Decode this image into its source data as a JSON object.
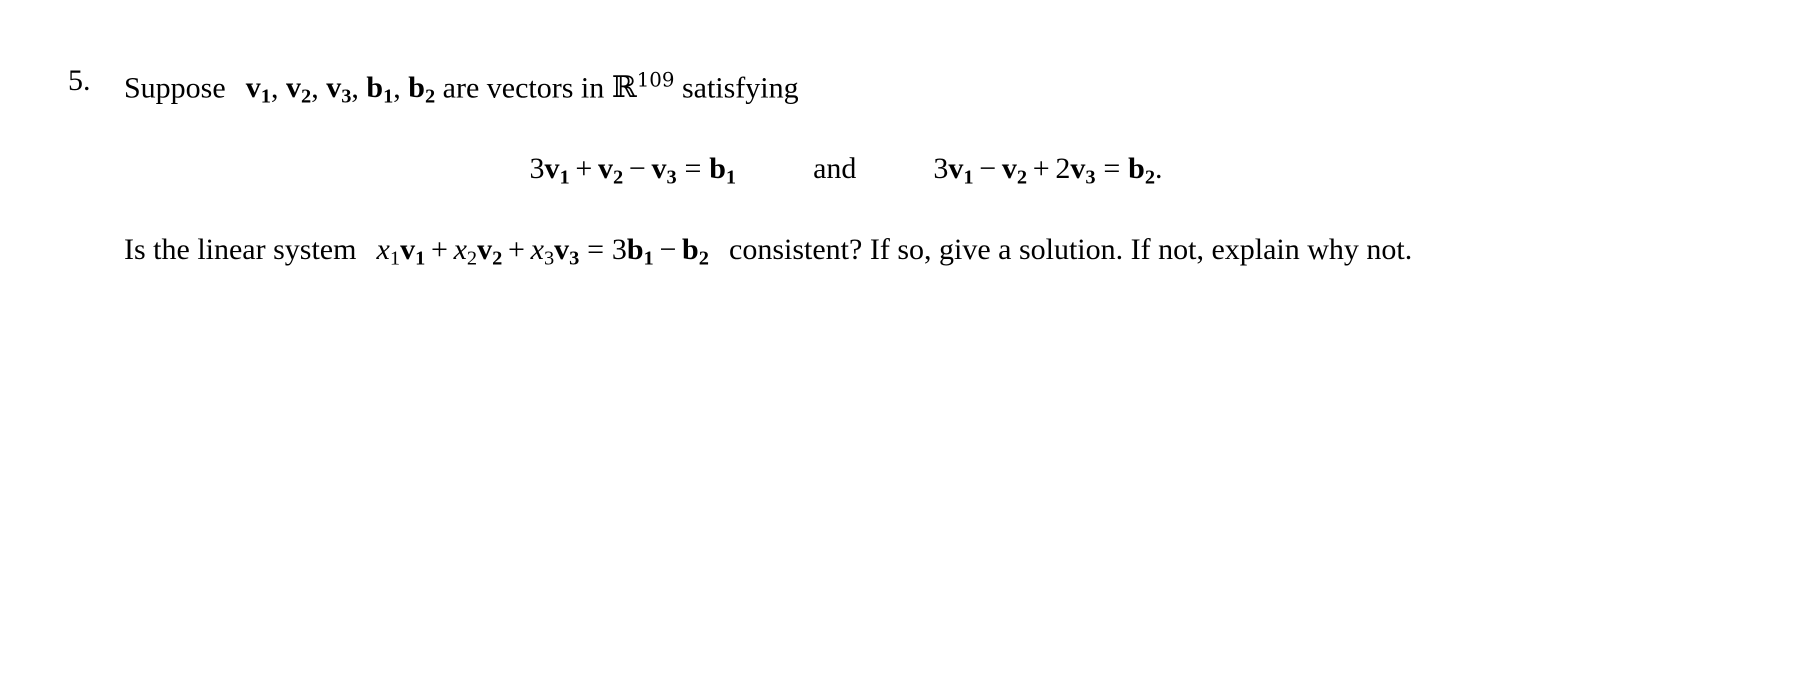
{
  "document": {
    "kind": "math-exercise",
    "background_color": "#ffffff",
    "text_color": "#000000"
  },
  "problem": {
    "number": "5.",
    "stem": {
      "lead": "Suppose",
      "vector_list": [
        "v",
        "v",
        "v",
        "b",
        "b"
      ],
      "vector_subscripts": [
        "1",
        "2",
        "3",
        "1",
        "2"
      ],
      "middle": "are vectors in",
      "field_symbol": "R",
      "field_exponent": "109",
      "trail": "satisfying",
      "full_text": "Suppose v1, v2, v3, b1, b2 are vectors in R^109 satisfying"
    },
    "equations": {
      "conjunction": "and",
      "first": {
        "coef1": "3",
        "var1": "v",
        "sub1": "1",
        "op1": "+",
        "coef2": "",
        "var2": "v",
        "sub2": "2",
        "op2": "−",
        "coef3": "",
        "var3": "v",
        "sub3": "3",
        "relation": "=",
        "rhs_var": "b",
        "rhs_sub": "1",
        "full_text": "3v1 + v2 − v3 = b1"
      },
      "second": {
        "coef1": "3",
        "var1": "v",
        "sub1": "1",
        "op1": "−",
        "coef2": "",
        "var2": "v",
        "sub2": "2",
        "op2": "+",
        "coef3": "2",
        "var3": "v",
        "sub3": "3",
        "relation": "=",
        "rhs_var": "b",
        "rhs_sub": "2",
        "terminator": ".",
        "full_text": "3v1 − v2 + 2v3 = b2."
      }
    },
    "question": {
      "lead": "Is the linear system",
      "system": {
        "t1_scalar": "x",
        "t1_scalar_sub": "1",
        "t1_vec": "v",
        "t1_vec_sub": "1",
        "op1": "+",
        "t2_scalar": "x",
        "t2_scalar_sub": "2",
        "t2_vec": "v",
        "t2_vec_sub": "2",
        "op2": "+",
        "t3_scalar": "x",
        "t3_scalar_sub": "3",
        "t3_vec": "v",
        "t3_vec_sub": "3",
        "relation": "=",
        "rhs_coef": "3",
        "rhs_var1": "b",
        "rhs_sub1": "1",
        "rhs_op": "−",
        "rhs_var2": "b",
        "rhs_sub2": "2",
        "full_text": "x1v1 + x2v2 + x3v3 = 3b1 − b2"
      },
      "tail": "consistent?  If so, give a solution.  If not, explain why not.",
      "full_text": "Is the linear system x1v1 + x2v2 + x3v3 = 3b1 − b2 consistent? If so, give a solution. If not, explain why not."
    }
  }
}
